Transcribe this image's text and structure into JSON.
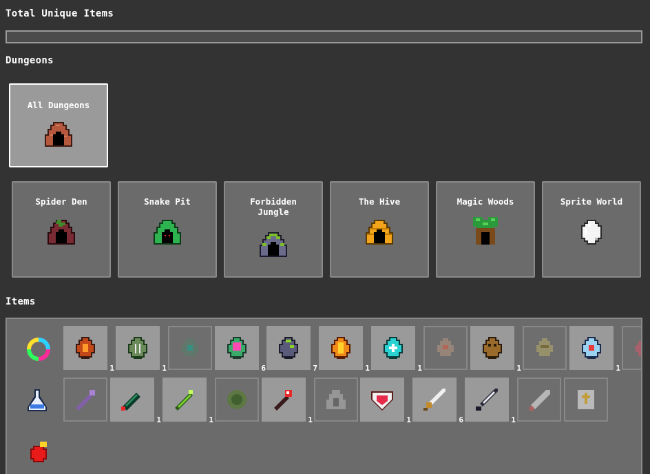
{
  "header": {
    "total_title": "Total Unique Items",
    "total_fraction": 0
  },
  "dungeons": {
    "title": "Dungeons",
    "all_label": "All Dungeons",
    "cards": [
      {
        "label": "Spider Den"
      },
      {
        "label": "Snake Pit"
      },
      {
        "label": "Forbidden Jungle"
      },
      {
        "label": "The Hive"
      },
      {
        "label": "Magic Woods"
      },
      {
        "label": "Sprite World"
      }
    ]
  },
  "items": {
    "title": "Items",
    "row1_counts": [
      "1",
      "1",
      "",
      "6",
      "7",
      "1",
      "1",
      "",
      "1",
      "",
      "1"
    ],
    "row2_counts": [
      "",
      "1",
      "1",
      "",
      "1",
      "",
      "1",
      "6",
      "1",
      "",
      ""
    ]
  },
  "colors": {
    "background": "#333333",
    "panel": "#6b6b6b",
    "slot": "#9a9a9a",
    "selected_border": "#ffffff"
  }
}
